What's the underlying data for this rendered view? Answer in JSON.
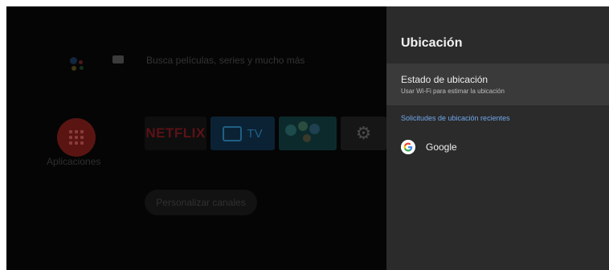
{
  "home": {
    "search_hint": "Busca películas, series y mucho más",
    "apps_label": "Aplicaciones",
    "netflix_label": "NETFLIX",
    "tv_label": "TV",
    "customize_label": "Personalizar canales"
  },
  "panel": {
    "title": "Ubicación",
    "status_item": {
      "title": "Estado de ubicación",
      "subtitle": "Usar Wi-Fi para estimar la ubicación"
    },
    "section_header": "Solicitudes de ubicación recientes",
    "recent_requests": [
      {
        "label": "Google",
        "icon": "google-icon"
      }
    ]
  },
  "colors": {
    "panel_bg": "#2b2b2b",
    "selected_bg": "#3a3a3a",
    "accent": "#71a9ef",
    "home_bg": "#050505"
  },
  "icons": {
    "assistant": "google-assistant-icon",
    "keyboard": "keyboard-icon",
    "apps": "apps-grid-icon",
    "tv": "tv-icon",
    "settings": "gear-icon"
  }
}
